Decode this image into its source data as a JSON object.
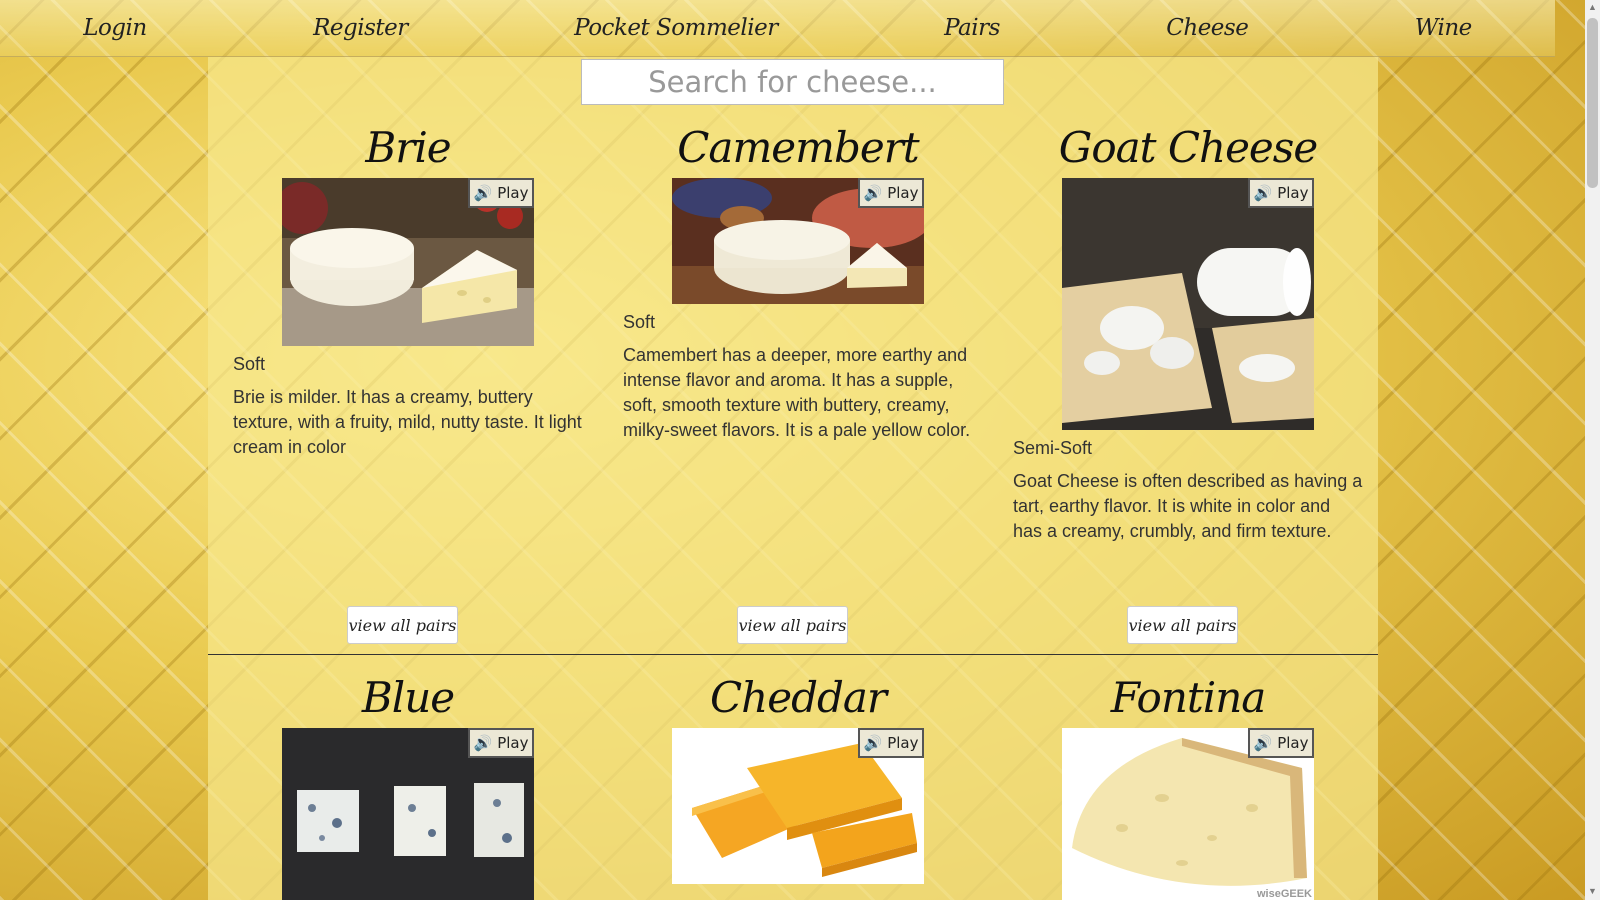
{
  "nav": {
    "login": "Login",
    "register": "Register",
    "brand": "Pocket Sommelier",
    "pairs": "Pairs",
    "cheese": "Cheese",
    "wine": "Wine"
  },
  "search": {
    "placeholder": "Search for cheese..."
  },
  "play_label": "Play",
  "pairs_label": "view all pairs",
  "cheeses": [
    {
      "name": "Brie",
      "texture": "Soft",
      "description": "Brie is milder. It has a creamy, buttery texture, with a fruity, mild, nutty taste. It light cream in color"
    },
    {
      "name": "Camembert",
      "texture": "Soft",
      "description": "Camembert has a deeper, more earthy and intense flavor and aroma. It has a supple, soft, smooth texture with buttery, creamy, milky-sweet flavors. It is a pale yellow color."
    },
    {
      "name": "Goat Cheese",
      "texture": "Semi-Soft",
      "description": "Goat Cheese is often described as having a tart, earthy flavor. It is white in color and has a creamy, crumbly, and firm texture."
    },
    {
      "name": "Blue"
    },
    {
      "name": "Cheddar"
    },
    {
      "name": "Fontina",
      "watermark": "wiseGEEK"
    }
  ]
}
